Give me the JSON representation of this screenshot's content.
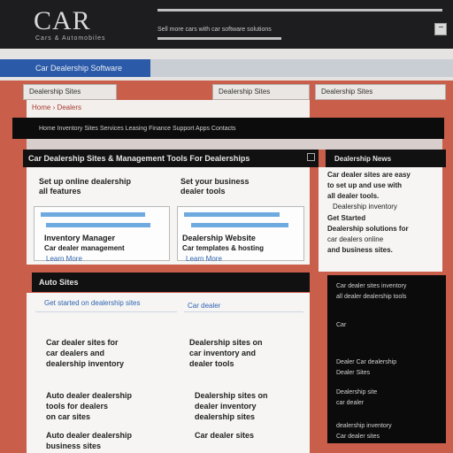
{
  "header": {
    "logo": "CAR",
    "logo_sub": "Cars & Automobiles",
    "top_text": "Sell more cars with car software solutions"
  },
  "nav": {
    "primary_label": "Car Dealership Software",
    "tabs": [
      "Dealership Sites",
      "Dealership Sites",
      "Dealership Sites"
    ],
    "breadcrumb": "Home › Dealers",
    "menu_text": "Home  Inventory  Sites  Services  Leasing  Finance  Support  Apps  Contacts"
  },
  "main": {
    "heading": "Car Dealership Sites & Management Tools For Dealerships",
    "intro_left": [
      "Set up online dealership",
      "all features"
    ],
    "intro_right": [
      "Set your business",
      "dealer tools"
    ],
    "items": [
      {
        "title": "Inventory Manager",
        "sub": "Car dealer management",
        "link": "Learn More"
      },
      {
        "title": "Dealership Website",
        "sub": "Car templates & hosting",
        "link": "Learn More"
      }
    ]
  },
  "sidebar": {
    "title": "Dealership News",
    "lines": [
      "Car dealer sites are easy",
      "to set up and use with",
      "all dealer tools.",
      "Dealership inventory",
      "Get Started",
      "Dealership solutions for",
      "car dealers online",
      "and business sites."
    ]
  },
  "section2": {
    "title": "Auto Sites",
    "link": "Get started on dealership sites",
    "rows": [
      [
        "Car dealer sites for",
        "car dealers and",
        "dealership inventory"
      ],
      [
        "Dealership sites on",
        "car inventory and",
        "dealer tools"
      ],
      [
        "Auto dealer dealership",
        "tools for dealers",
        "on car sites"
      ],
      [
        "Dealership sites on",
        "dealer inventory",
        "dealership sites"
      ],
      [
        "Auto dealer dealership",
        "business sites"
      ],
      [
        "Car dealer sites"
      ]
    ],
    "sublink": "Car dealer"
  },
  "panel": {
    "lines": [
      "Car dealer sites inventory",
      "all dealer dealership tools",
      "Car",
      "Dealer Car dealership",
      "Dealer Sites",
      "Dealership site",
      "car dealer",
      "dealership inventory",
      "Car dealer sites"
    ]
  },
  "colors": {
    "banner": "#c95e4b",
    "accent_blue": "#2a5aa8",
    "link_blue": "#2f64b0",
    "dark": "#111111"
  }
}
